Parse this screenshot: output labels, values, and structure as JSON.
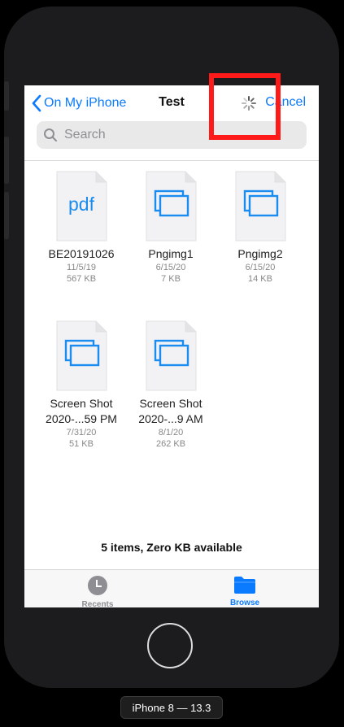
{
  "nav": {
    "back_label": "On My iPhone",
    "title": "Test",
    "cancel_label": "Cancel"
  },
  "search": {
    "placeholder": "Search"
  },
  "files": [
    {
      "name": "BE20191026",
      "name2": "",
      "date": "11/5/19",
      "size": "567 KB",
      "icon": "pdf-file-icon",
      "pdf_text": "pdf"
    },
    {
      "name": "Pngimg1",
      "name2": "",
      "date": "6/15/20",
      "size": "7 KB",
      "icon": "image-file-icon"
    },
    {
      "name": "Pngimg2",
      "name2": "",
      "date": "6/15/20",
      "size": "14 KB",
      "icon": "image-file-icon"
    },
    {
      "name": "Screen Shot",
      "name2": "2020-...59 PM",
      "date": "7/31/20",
      "size": "51 KB",
      "icon": "image-file-icon"
    },
    {
      "name": "Screen Shot",
      "name2": "2020-...9 AM",
      "date": "8/1/20",
      "size": "262 KB",
      "icon": "image-file-icon"
    }
  ],
  "footer": {
    "item_count": "5 items, Zero KB available"
  },
  "tabs": [
    {
      "label": "Recents",
      "icon": "clock-icon",
      "color": "#8e8e93"
    },
    {
      "label": "Browse",
      "icon": "folder-icon",
      "color": "#0a7aff"
    }
  ],
  "device": {
    "label": "iPhone 8 — 13.3"
  },
  "colors": {
    "accent": "#0a7aff",
    "highlight_box": "#ff1a1a"
  }
}
